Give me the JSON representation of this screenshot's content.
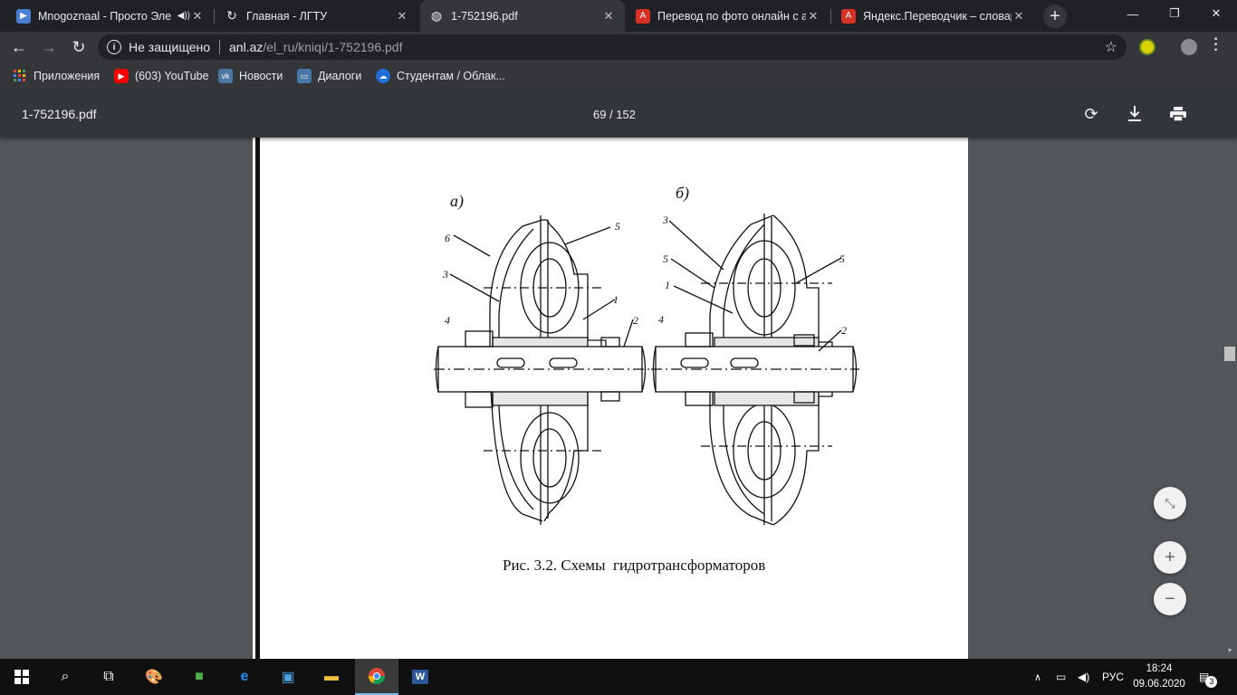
{
  "browser": {
    "tabs": [
      {
        "title": "Mnogoznaal - Просто Эле",
        "favicon": "media-play-icon",
        "audio": true
      },
      {
        "title": "Главная - ЛГТУ",
        "favicon": "loading-icon"
      },
      {
        "title": "1-752196.pdf",
        "favicon": "globe-icon",
        "active": true
      },
      {
        "title": "Перевод по фото онлайн с ан",
        "favicon": "translate-icon"
      },
      {
        "title": "Яндекс.Переводчик – словарь",
        "favicon": "translate-icon"
      }
    ],
    "new_tab": "+",
    "window_controls": {
      "minimize": "—",
      "maximize": "❐",
      "close": "✕"
    },
    "address": {
      "security_label": "Не защищено",
      "host": "anl.az",
      "path": "/el_ru/kniqi/1-752196.pdf"
    },
    "bookmarks": [
      {
        "label": "Приложения",
        "icon": "apps-grid-icon"
      },
      {
        "label": "(603) YouTube",
        "icon": "youtube-icon"
      },
      {
        "label": "Новости",
        "icon": "vk-icon"
      },
      {
        "label": "Диалоги",
        "icon": "chat-icon"
      },
      {
        "label": "Студентам / Облак...",
        "icon": "cloud-icon"
      }
    ]
  },
  "pdf": {
    "title": "1-752196.pdf",
    "page_indicator": "69 / 152",
    "figure": {
      "label_a": "а)",
      "label_b": "б)",
      "callouts_a": [
        "6",
        "5",
        "3",
        "1",
        "4",
        "2"
      ],
      "callouts_b": [
        "3",
        "5",
        "5",
        "1",
        "4",
        "2"
      ],
      "caption": "Рис. 3.2. Схемы  гидротрансформаторов"
    }
  },
  "taskbar": {
    "language": "РУС",
    "time": "18:24",
    "date": "09.06.2020",
    "notifications": "3"
  },
  "colors": {
    "tabbar": "#202124",
    "toolbar": "#35363a",
    "pdf_toolbar": "#323639",
    "viewer_bg": "#525659",
    "taskbar": "#101010"
  }
}
